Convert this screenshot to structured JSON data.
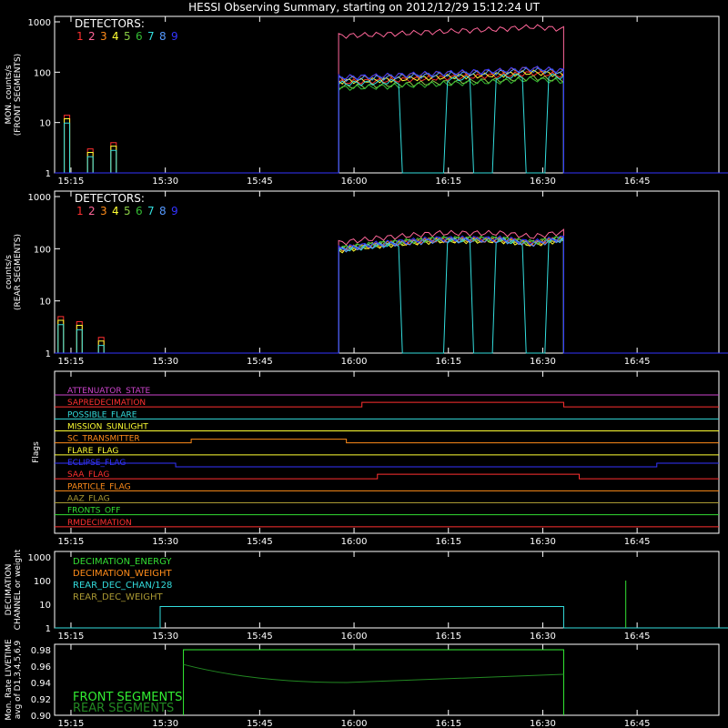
{
  "title": "HESSI Observing Summary, starting on 2012/12/29 15:12:24 UT",
  "detector_colors": [
    "#ff3030",
    "#ff6699",
    "#ff8c1a",
    "#ffff33",
    "#88cc44",
    "#33bb33",
    "#33dddd",
    "#5599ff",
    "#3333ff"
  ],
  "time_ticks": [
    "15:15",
    "15:30",
    "15:45",
    "16:00",
    "16:15",
    "16:30",
    "16:45"
  ],
  "chart_data": [
    {
      "type": "line",
      "panel": "front",
      "ylabel_lines": [
        "MON. counts/s",
        "(FRONT SEGMENTS)"
      ],
      "yscale": "log",
      "ylim": [
        1,
        1000
      ],
      "ytick_labels": [
        "1",
        "10",
        "100",
        "1000"
      ],
      "xlim_minutes": [
        15.2,
        58.0
      ],
      "legend_title": "DETECTORS:",
      "legend_labels": [
        "1",
        "2",
        "3",
        "4",
        "5",
        "6",
        "7",
        "8",
        "9"
      ],
      "segments": [
        {
          "start": 33.5,
          "end": 48.0,
          "top_curve": [
            [
              33.5,
              530
            ],
            [
              36,
              560
            ],
            [
              40,
              640
            ],
            [
              44,
              720
            ],
            [
              46,
              800
            ],
            [
              48,
              720
            ]
          ]
        },
        {
          "start": 73.0,
          "end": 78.0,
          "top_curve": [
            [
              73,
              560
            ],
            [
              78,
              540
            ]
          ]
        }
      ],
      "early_spikes": [
        [
          16.0,
          14
        ],
        [
          17.5,
          3
        ],
        [
          19.0,
          4
        ]
      ],
      "dropouts": [
        [
          37.5,
          40.5
        ],
        [
          42.0,
          43.5
        ],
        [
          45.5,
          47.0
        ]
      ]
    },
    {
      "type": "line",
      "panel": "rear",
      "ylabel_lines": [
        "counts/s",
        "(REAR SEGMENTS)"
      ],
      "yscale": "log",
      "ylim": [
        1,
        1000
      ],
      "ytick_labels": [
        "1",
        "10",
        "100",
        "1000"
      ],
      "xlim_minutes": [
        15.2,
        58.0
      ],
      "legend_title": "DETECTORS:",
      "legend_labels": [
        "1",
        "2",
        "3",
        "4",
        "5",
        "6",
        "7",
        "8",
        "9"
      ],
      "segments": [
        {
          "start": 33.5,
          "end": 48.0,
          "top_curve": [
            [
              33.5,
              130
            ],
            [
              36,
              160
            ],
            [
              40,
              200
            ],
            [
              44,
              200
            ],
            [
              46,
              170
            ],
            [
              48,
              210
            ]
          ]
        },
        {
          "start": 73.0,
          "end": 78.0,
          "top_curve": [
            [
              73,
              200
            ],
            [
              78,
              160
            ]
          ]
        }
      ],
      "early_spikes": [
        [
          15.6,
          5
        ],
        [
          16.8,
          4
        ],
        [
          18.2,
          2
        ]
      ],
      "dropouts": [
        [
          37.5,
          40.5
        ],
        [
          42.0,
          43.5
        ],
        [
          45.5,
          47.0
        ]
      ]
    },
    {
      "type": "line",
      "panel": "flags",
      "ylabel": "Flags",
      "flags": [
        {
          "name": "ATTENUATOR_STATE",
          "color": "#cc44cc"
        },
        {
          "name": "SAPREDECIMATION",
          "color": "#ff3030"
        },
        {
          "name": "POSSIBLE_FLARE",
          "color": "#33dddd"
        },
        {
          "name": "MISSION_SUNLIGHT",
          "color": "#ffff33"
        },
        {
          "name": "SC_TRANSMITTER",
          "color": "#ff8c1a"
        },
        {
          "name": "FLARE_FLAG",
          "color": "#ffff33"
        },
        {
          "name": "ECLIPSE_FLAG",
          "color": "#3333ff"
        },
        {
          "name": "SAA_FLAG",
          "color": "#ff3030"
        },
        {
          "name": "PARTICLE_FLAG",
          "color": "#ff8c1a"
        },
        {
          "name": "AAZ_FLAG",
          "color": "#aa9933"
        },
        {
          "name": "FRONTS_OFF",
          "color": "#33dd33"
        },
        {
          "name": "RMDECIMATION",
          "color": "#ff3030"
        }
      ]
    },
    {
      "type": "line",
      "panel": "decimation",
      "ylabel_lines": [
        "DECIMATION",
        "CHANNEL or weight"
      ],
      "yscale": "log",
      "ylim": [
        1,
        1000
      ],
      "ytick_labels": [
        "1",
        "10",
        "100",
        "1000"
      ],
      "series": [
        {
          "name": "DECIMATION_ENERGY",
          "color": "#33dd33"
        },
        {
          "name": "DECIMATION_WEIGHT",
          "color": "#ff8c1a"
        },
        {
          "name": "REAR_DEC_CHAN/128",
          "color": "#33dddd"
        },
        {
          "name": "REAR_DEC_WEIGHT",
          "color": "#aa9933"
        }
      ]
    },
    {
      "type": "line",
      "panel": "livetime",
      "ylabel_lines": [
        "Mon. Rate LIVETIME",
        "avg of D1,3,4,5,6,9"
      ],
      "ylim": [
        0.9,
        0.98
      ],
      "ytick_labels": [
        "0.90",
        "0.92",
        "0.94",
        "0.96",
        "0.98"
      ],
      "series": [
        {
          "name": "FRONT SEGMENTS",
          "color": "#33ee33"
        },
        {
          "name": "REAR SEGMENTS",
          "color": "#228822"
        }
      ]
    }
  ]
}
